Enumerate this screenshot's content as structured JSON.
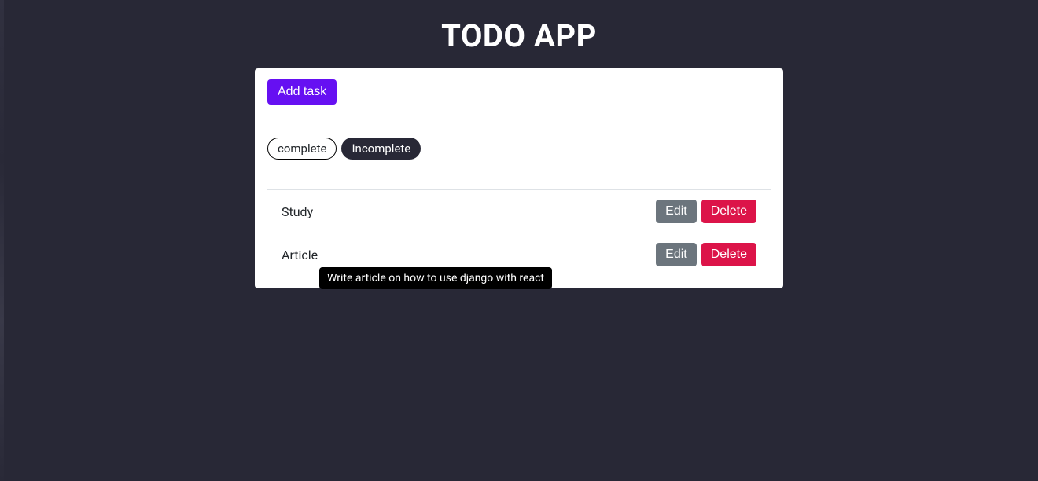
{
  "header": {
    "title": "TODO APP"
  },
  "buttons": {
    "add_task": "Add task",
    "edit": "Edit",
    "delete": "Delete"
  },
  "filters": {
    "complete": "complete",
    "incomplete": "Incomplete",
    "active": "incomplete"
  },
  "tasks": [
    {
      "title": "Study"
    },
    {
      "title": "Article",
      "tooltip": "Write article on how to use django with react"
    }
  ],
  "tooltip": {
    "text": "Write article on how to use django with react"
  }
}
